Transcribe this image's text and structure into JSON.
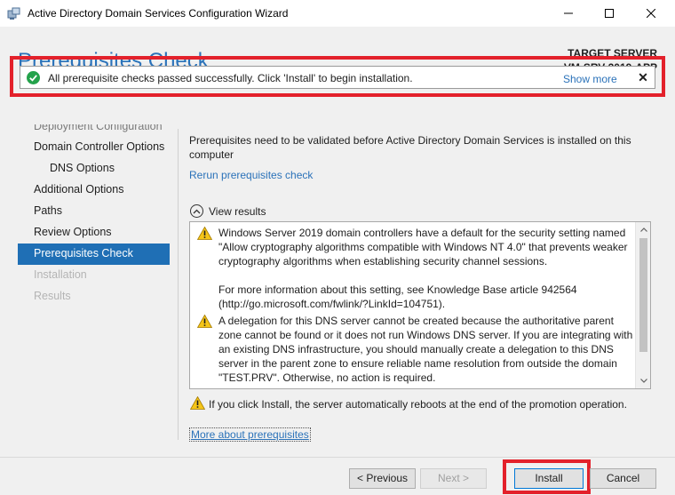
{
  "window": {
    "title": "Active Directory Domain Services Configuration Wizard",
    "minimize_icon": "minimize-icon",
    "maximize_icon": "maximize-icon",
    "close_icon": "close-icon"
  },
  "header": {
    "page_title": "Prerequisites Check",
    "target_label": "TARGET SERVER",
    "target_name": "VM-SRV-2019-APP"
  },
  "banner": {
    "message": "All prerequisite checks passed successfully.  Click 'Install' to begin installation.",
    "show_more": "Show more",
    "close_glyph": "✕",
    "status_color": "#24a24b",
    "highlight_color": "#e3212b"
  },
  "nav": {
    "items": [
      {
        "label": "Deployment Configuration",
        "state": "clipped"
      },
      {
        "label": "Domain Controller Options",
        "state": "normal"
      },
      {
        "label": "DNS Options",
        "state": "sub"
      },
      {
        "label": "Additional Options",
        "state": "normal"
      },
      {
        "label": "Paths",
        "state": "normal"
      },
      {
        "label": "Review Options",
        "state": "normal"
      },
      {
        "label": "Prerequisites Check",
        "state": "active"
      },
      {
        "label": "Installation",
        "state": "disabled"
      },
      {
        "label": "Results",
        "state": "disabled"
      }
    ],
    "active_color": "#1f6fb5"
  },
  "content": {
    "intro": "Prerequisites need to be validated before Active Directory Domain Services is installed on this computer",
    "rerun_link": "Rerun prerequisites check",
    "view_results": "View results",
    "results": [
      {
        "text": "Windows Server 2019 domain controllers have a default for the security setting named \"Allow cryptography algorithms compatible with Windows NT 4.0\" that prevents weaker cryptography algorithms when establishing security channel sessions.\n\nFor more information about this setting, see Knowledge Base article 942564 (http://go.microsoft.com/fwlink/?LinkId=104751)."
      },
      {
        "text": "A delegation for this DNS server cannot be created because the authoritative parent zone cannot be found or it does not run Windows DNS server. If you are integrating with an existing DNS infrastructure, you should manually create a delegation to this DNS server in the parent zone to ensure reliable name resolution from outside the domain \"TEST.PRV\". Otherwise, no action is required."
      }
    ],
    "reboot_note": "If you click Install, the server automatically reboots at the end of the promotion operation.",
    "more_link": "More about prerequisites",
    "link_color": "#2b72b9"
  },
  "footer": {
    "previous": "< Previous",
    "next": "Next >",
    "install": "Install",
    "cancel": "Cancel"
  }
}
